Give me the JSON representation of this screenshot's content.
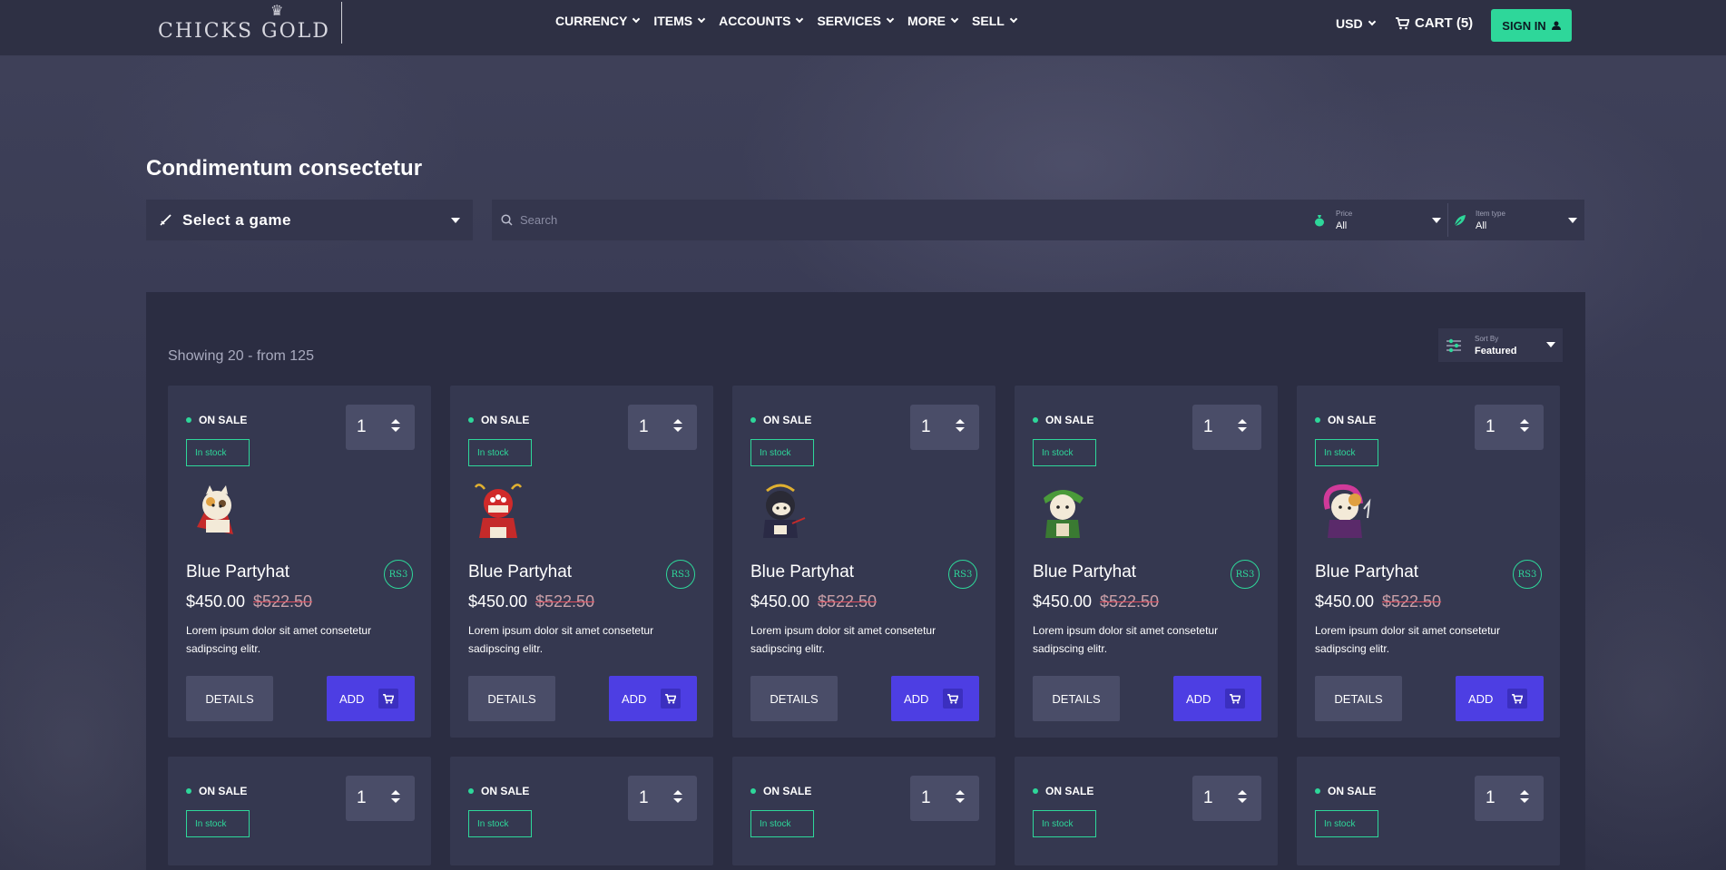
{
  "header": {
    "logo_text": "CHICKS GOLD",
    "nav": [
      "CURRENCY",
      "ITEMS",
      "ACCOUNTS",
      "SERVICES",
      "MORE",
      "SELL"
    ],
    "currency": "USD",
    "cart_label": "CART (5)",
    "signin_label": "SIGN IN"
  },
  "filters": {
    "title": "Condimentum consectetur",
    "game_select": "Select a game",
    "search_placeholder": "Search",
    "price_label": "Price",
    "price_value": "All",
    "item_type_label": "Item type",
    "item_type_value": "All"
  },
  "listing": {
    "showing": "Showing 20 - from 125",
    "sort_label": "Sort By",
    "sort_value": "Featured"
  },
  "colors": {
    "accent": "#2ed79a",
    "add_button": "#4d3ee3",
    "panel": "#2b2d42",
    "card": "#353850"
  },
  "products": [
    {
      "status": "ON SALE",
      "stock": "In stock",
      "qty": "1",
      "name": "Blue Partyhat",
      "badge": "RS3",
      "price": "$450.00",
      "old_price": "$522.50",
      "description": "Lorem ipsum dolor sit amet consetetur sadipscing elitr.",
      "details_label": "DETAILS",
      "add_label": "ADD",
      "avatar": "cat-samurai"
    },
    {
      "status": "ON SALE",
      "stock": "In stock",
      "qty": "1",
      "name": "Blue Partyhat",
      "badge": "RS3",
      "price": "$450.00",
      "old_price": "$522.50",
      "description": "Lorem ipsum dolor sit amet consetetur sadipscing elitr.",
      "details_label": "DETAILS",
      "add_label": "ADD",
      "avatar": "red-samurai"
    },
    {
      "status": "ON SALE",
      "stock": "In stock",
      "qty": "1",
      "name": "Blue Partyhat",
      "badge": "RS3",
      "price": "$450.00",
      "old_price": "$522.50",
      "description": "Lorem ipsum dolor sit amet consetetur sadipscing elitr.",
      "details_label": "DETAILS",
      "add_label": "ADD",
      "avatar": "black-samurai"
    },
    {
      "status": "ON SALE",
      "stock": "In stock",
      "qty": "1",
      "name": "Blue Partyhat",
      "badge": "RS3",
      "price": "$450.00",
      "old_price": "$522.50",
      "description": "Lorem ipsum dolor sit amet consetetur sadipscing elitr.",
      "details_label": "DETAILS",
      "add_label": "ADD",
      "avatar": "green-samurai"
    },
    {
      "status": "ON SALE",
      "stock": "In stock",
      "qty": "1",
      "name": "Blue Partyhat",
      "badge": "RS3",
      "price": "$450.00",
      "old_price": "$522.50",
      "description": "Lorem ipsum dolor sit amet consetetur sadipscing elitr.",
      "details_label": "DETAILS",
      "add_label": "ADD",
      "avatar": "pink-samurai"
    },
    {
      "status": "ON SALE",
      "stock": "In stock",
      "qty": "1"
    },
    {
      "status": "ON SALE",
      "stock": "In stock",
      "qty": "1"
    },
    {
      "status": "ON SALE",
      "stock": "In stock",
      "qty": "1"
    },
    {
      "status": "ON SALE",
      "stock": "In stock",
      "qty": "1"
    },
    {
      "status": "ON SALE",
      "stock": "In stock",
      "qty": "1"
    }
  ]
}
